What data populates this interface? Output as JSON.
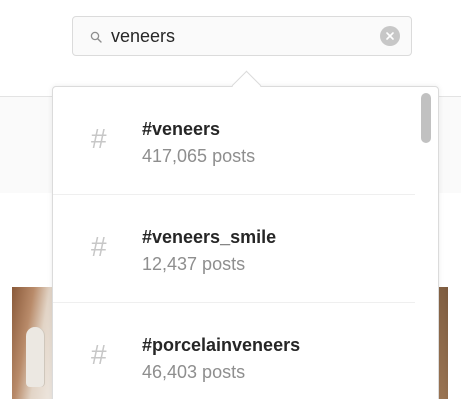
{
  "search": {
    "value": "veneers",
    "placeholder": "Search",
    "icon": "search-icon",
    "clear_icon": "clear-circle-icon"
  },
  "results": [
    {
      "icon": "hashtag-icon",
      "hash": "#",
      "tag": "#veneers",
      "posts": "417,065 posts"
    },
    {
      "icon": "hashtag-icon",
      "hash": "#",
      "tag": "#veneers_smile",
      "posts": "12,437 posts"
    },
    {
      "icon": "hashtag-icon",
      "hash": "#",
      "tag": "#porcelainveneers",
      "posts": "46,403 posts"
    }
  ],
  "colors": {
    "text": "#262626",
    "secondary_text": "#8e8e8e",
    "hash_icon": "#c7c7c7",
    "border": "#dbdbdb"
  }
}
